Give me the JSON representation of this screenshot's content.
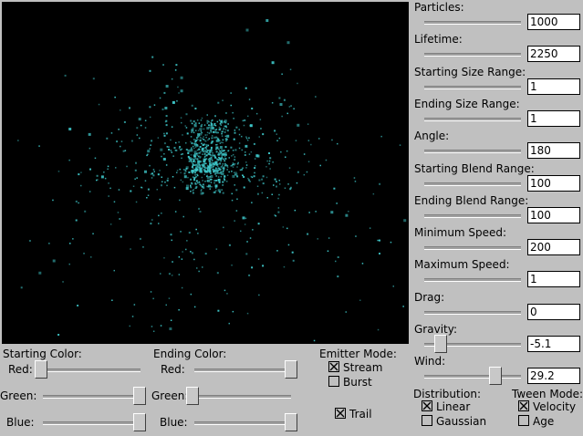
{
  "params": [
    {
      "key": "particles",
      "label": "Particles:",
      "value": "1000"
    },
    {
      "key": "lifetime",
      "label": "Lifetime:",
      "value": "2250"
    },
    {
      "key": "start_size",
      "label": "Starting Size Range:",
      "value": "1"
    },
    {
      "key": "end_size",
      "label": "Ending Size Range:",
      "value": "1"
    },
    {
      "key": "angle",
      "label": "Angle:",
      "value": "180"
    },
    {
      "key": "start_blend",
      "label": "Starting Blend Range:",
      "value": "100"
    },
    {
      "key": "end_blend",
      "label": "Ending Blend Range:",
      "value": "100"
    },
    {
      "key": "min_speed",
      "label": "Minimum Speed:",
      "value": "200"
    },
    {
      "key": "max_speed",
      "label": "Maximum Speed:",
      "value": "1"
    },
    {
      "key": "drag",
      "label": "Drag:",
      "value": "0"
    },
    {
      "key": "gravity",
      "label": "Gravity:",
      "value": "-5.1",
      "slider_level": 0.12
    },
    {
      "key": "wind",
      "label": "Wind:",
      "value": "29.2",
      "slider_level": 0.77
    }
  ],
  "starting_color": {
    "title": "Starting Color:",
    "red_label": "Red:",
    "green_label": "Green:",
    "blue_label": "Blue:",
    "red_level": 0.0,
    "green_level": 1.0,
    "blue_level": 1.0
  },
  "ending_color": {
    "title": "Ending Color:",
    "red_label": "Red:",
    "green_label": "Green:",
    "blue_label": "Blue:",
    "red_level": 1.0,
    "green_level": 0.0,
    "blue_level": 1.0
  },
  "emitter_mode": {
    "title": "Emitter Mode:",
    "stream_label": "Stream",
    "stream_checked": true,
    "burst_label": "Burst",
    "burst_checked": false
  },
  "trail": {
    "label": "Trail",
    "checked": true
  },
  "distribution": {
    "title": "Distribution:",
    "linear_label": "Linear",
    "linear_checked": true,
    "gaussian_label": "Gaussian",
    "gaussian_checked": false
  },
  "tween_mode": {
    "title": "Tween Mode:",
    "velocity_label": "Velocity",
    "velocity_checked": true,
    "age_label": "Age",
    "age_checked": false
  },
  "colors": {
    "particle": "#3ec7c9",
    "viewport_bg": "#000000",
    "panel_bg": "#c0c0c0"
  }
}
